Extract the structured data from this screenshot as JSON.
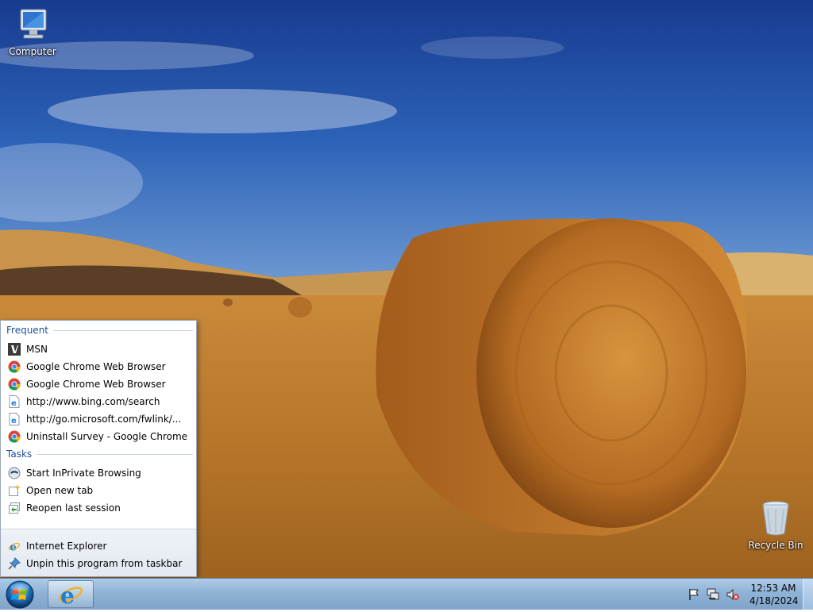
{
  "desktop": {
    "icons": [
      {
        "label": "Computer",
        "icon": "computer-icon"
      },
      {
        "label": "Recycle Bin",
        "icon": "recycle-bin-icon"
      }
    ]
  },
  "jumplist": {
    "frequent_header": "Frequent",
    "frequent": [
      {
        "label": "MSN",
        "icon": "msn-icon"
      },
      {
        "label": "Google Chrome Web Browser",
        "icon": "chrome-icon"
      },
      {
        "label": "Google Chrome Web Browser",
        "icon": "chrome-icon"
      },
      {
        "label": "http://www.bing.com/search",
        "icon": "ie-page-icon"
      },
      {
        "label": "http://go.microsoft.com/fwlink/...",
        "icon": "ie-page-icon"
      },
      {
        "label": "Uninstall Survey - Google Chrome",
        "icon": "chrome-icon"
      }
    ],
    "tasks_header": "Tasks",
    "tasks": [
      {
        "label": "Start InPrivate Browsing",
        "icon": "inprivate-icon"
      },
      {
        "label": "Open new tab",
        "icon": "new-tab-icon"
      },
      {
        "label": "Reopen last session",
        "icon": "reopen-session-icon"
      }
    ],
    "bottom": [
      {
        "label": "Internet Explorer",
        "icon": "internet-explorer-icon"
      },
      {
        "label": "Unpin this program from taskbar",
        "icon": "unpin-icon"
      }
    ]
  },
  "taskbar": {
    "clock_time": "12:53 AM",
    "clock_date": "4/18/2024",
    "tray_icons": [
      "action-center-flag-icon",
      "network-icon",
      "volume-muted-icon"
    ],
    "colors": {
      "taskbar": "#8fb3d6",
      "accent": "#1e4f9c"
    }
  }
}
